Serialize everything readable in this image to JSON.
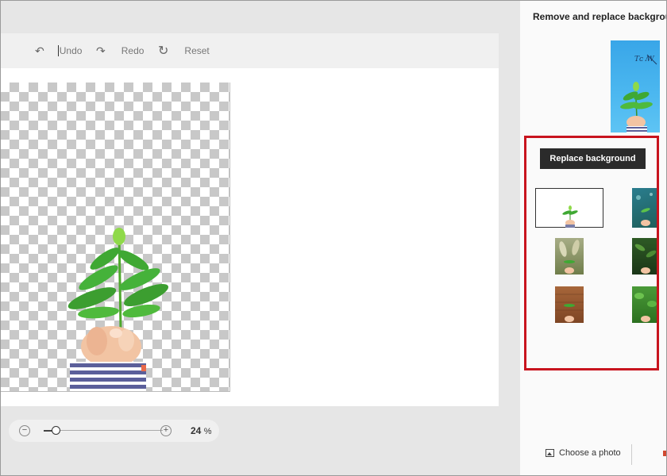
{
  "toolbar": {
    "undo_label": "Undo",
    "redo_label": "Redo",
    "reset_label": "Reset",
    "undo_icon": "undo-arrow-icon",
    "redo_icon": "redo-arrow-icon",
    "reset_icon": "reset-rotate-icon"
  },
  "zoom": {
    "minus_label": "−",
    "plus_label": "+",
    "value": "24",
    "unit": "%",
    "slider_level_fraction": 0.1
  },
  "panel": {
    "title": "Remove and replace backgrou",
    "replace_button_label": "Replace background",
    "choose_photo_label": "Choose a photo",
    "highlight_color": "#c8141e",
    "thumbnails": [
      {
        "name": "thumb-plain-white",
        "selected": true,
        "bg": "#ffffff"
      },
      {
        "name": "thumb-teal-bokeh",
        "selected": false,
        "bg": "#2b7f86"
      },
      {
        "name": "thumb-pampas-grass",
        "selected": false,
        "bg": "#9aa577"
      },
      {
        "name": "thumb-dark-leaves",
        "selected": false,
        "bg": "#27461f"
      },
      {
        "name": "thumb-brick-wall",
        "selected": false,
        "bg": "#9b5a32"
      },
      {
        "name": "thumb-green-foliage",
        "selected": false,
        "bg": "#3c8a2e"
      }
    ]
  },
  "colors": {
    "accent_dark": "#2b2b2b",
    "highlight_red": "#c8141e",
    "checker_gray": "#c8c8c8"
  }
}
